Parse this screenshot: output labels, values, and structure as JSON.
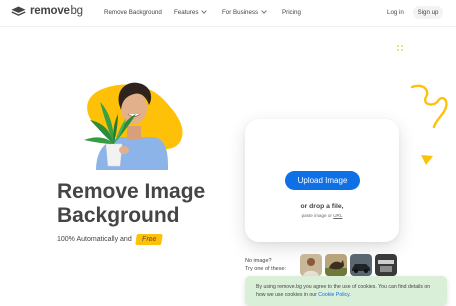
{
  "header": {
    "logo": {
      "word1": "remove",
      "word2": "bg"
    },
    "nav": [
      {
        "label": "Remove Background",
        "has_dropdown": false
      },
      {
        "label": "Features",
        "has_dropdown": true
      },
      {
        "label": "For Business",
        "has_dropdown": true
      },
      {
        "label": "Pricing",
        "has_dropdown": false
      }
    ],
    "login_label": "Log in",
    "signup_label": "Sign up"
  },
  "hero": {
    "title_line1": "Remove Image",
    "title_line2": "Background",
    "subtitle": "100% Automatically and",
    "badge": "Free"
  },
  "upload": {
    "button_label": "Upload Image",
    "drop_text": "or drop a file,",
    "paste_text": "paste image or",
    "paste_link": "URL"
  },
  "samples": {
    "line1": "No image?",
    "line2": "Try one of these:",
    "thumbnails": [
      "sample-person-icon",
      "sample-animal-icon",
      "sample-car-icon",
      "sample-product-icon"
    ]
  },
  "cookie": {
    "text_before": "By using remove.bg you agree to the use of cookies. You can find details on how we use cookies in our",
    "link": "Cookie Policy",
    "text_after": "."
  },
  "colors": {
    "accent_blue": "#0f70e6",
    "accent_yellow": "#ffc107",
    "text": "#454545",
    "cookie_bg": "#d9efd7"
  }
}
